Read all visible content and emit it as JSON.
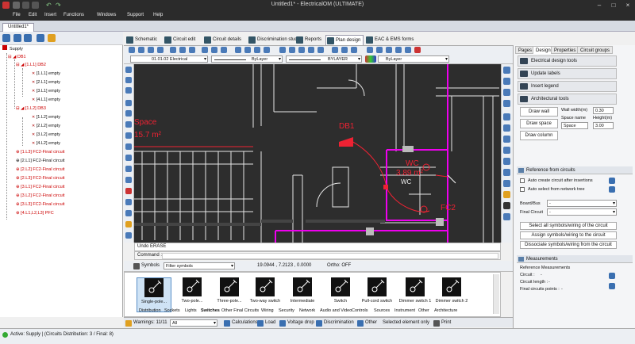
{
  "window": {
    "title": "Untitled1* - ElectricalOM (ULTIMATE)"
  },
  "menu": [
    "File",
    "Edit",
    "Insert",
    "Functions",
    "Windows",
    "Support",
    "Help"
  ],
  "doc_tab": "Untitled1*",
  "tree": {
    "root": "Supply",
    "nodes": [
      {
        "label": "DB1",
        "red": true
      },
      {
        "label": "[1.L1] DB2",
        "red": true
      },
      {
        "label": "[1.L1] empty"
      },
      {
        "label": "[2.L1] empty"
      },
      {
        "label": "[3.L1] empty"
      },
      {
        "label": "[4.L1] empty"
      },
      {
        "label": "[1.L2] DB3",
        "red": true
      },
      {
        "label": "[1.L2] empty"
      },
      {
        "label": "[2.L2] empty"
      },
      {
        "label": "[3.L2] empty"
      },
      {
        "label": "[4.L2] empty"
      },
      {
        "label": "[1.L3] FC2-Final circuit",
        "red": true
      },
      {
        "label": "[2.L1] FC2-Final circuit"
      },
      {
        "label": "[2.L2] FC2-Final circuit",
        "red": true
      },
      {
        "label": "[2.L3] FC2-Final circuit",
        "red": true
      },
      {
        "label": "[3.L1] FC2-Final circuit",
        "red": true
      },
      {
        "label": "[3.L2] FC2-Final circuit",
        "red": true
      },
      {
        "label": "[3.L3] FC2-Final circuit",
        "red": true
      },
      {
        "label": "[4.L1,L2,L3] PFC",
        "red": true
      }
    ]
  },
  "view_tabs": [
    "Schematic",
    "Circuit edit",
    "Circuit details",
    "Discrimination study",
    "Reports",
    "Plan design",
    "EAC & EMS forms"
  ],
  "active_view_tab": "Plan design",
  "toolbar": {
    "layer": "01.01.02 Electrical",
    "line1": "ByLayer",
    "line2": "BYLAYER",
    "color": "ByLayer"
  },
  "canvas": {
    "space_label": "Space",
    "space_area": "15.7 m²",
    "db1_label": "DB1",
    "wc_label": "WC",
    "wc_area": "3.89 m²",
    "wc_inner": "WC",
    "fc2_label": "FC2"
  },
  "command": {
    "history": "Undo ERASE",
    "prompt": "Command :"
  },
  "symbols_bar": {
    "tab": "Symbols",
    "filter_placeholder": "Filter symbols",
    "coords": "19.0944 , 7.2123 , 0.0000",
    "ortho": "Ortho: OFF"
  },
  "symbols": [
    "Single-pole...",
    "Two-pole...",
    "Three-pole...",
    "Two-way switch",
    "Intermediate",
    "Switch",
    "Pull-cord switch",
    "Dimmer switch 1",
    "Dimmer switch 2"
  ],
  "symbol_categories": [
    "Distribution",
    "Sockets",
    "Lights",
    "Switches",
    "Other Final Circuits",
    "Wiring",
    "Security",
    "Network",
    "Audio and Video",
    "Controls",
    "Sources",
    "Instrument",
    "Other",
    "Architecture"
  ],
  "active_category": "Switches",
  "bottom": {
    "warnings": "Warnings: 11/11",
    "filter": "All",
    "buttons": [
      "Calculations",
      "Load",
      "Voltage drop",
      "Discrimination",
      "Other"
    ],
    "selected_only": "Selected element only",
    "print": "Print"
  },
  "status": {
    "text": "Active: Supply | (Circuits Distribution: 3 / Final: 8)"
  },
  "right_panel": {
    "tabs": [
      "Pages",
      "Design",
      "Properties",
      "Circuit groups"
    ],
    "active_tab": "Design",
    "buttons": [
      "Electrical design tools",
      "Update labels",
      "Insert legend",
      "Architectural tools"
    ],
    "arch": {
      "draw_wall": "Draw wall",
      "draw_space": "Draw space",
      "draw_column": "Draw column",
      "wall_width_label": "Wall width(m)",
      "wall_width": "0.30",
      "space_name_label": "Space name",
      "space_name": "Space",
      "height_label": "Height(m)",
      "height": "3.00"
    },
    "reference_section": "Reference from circuits",
    "auto_create": "Auto create circuit after insertions",
    "auto_select": "Auto select from network tree",
    "board_bus_label": "Board/Bus",
    "board_bus_value": "-",
    "final_circuit_label": "Final Circuit",
    "final_circuit_value": "-",
    "ref_buttons": [
      "Select all symbols/wiring of the circuit",
      "Assign symbols/wiring to the circuit",
      "Dissociate symbols/wiring from the circuit"
    ],
    "measurements_section": "Measurements",
    "ref_measurements": "Reference Measurements",
    "circuit_label": "Circuit :",
    "circuit_value": "-",
    "circuit_length_label": "Circuit length :",
    "circuit_length_value": "-",
    "final_points_label": "Final circuits points :",
    "final_points_value": "-"
  }
}
